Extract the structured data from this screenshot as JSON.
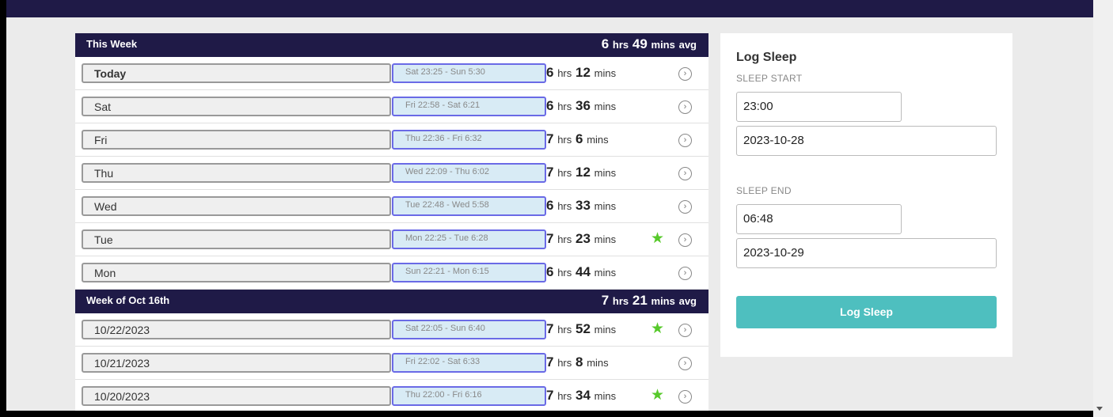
{
  "weeks": [
    {
      "title": "This Week",
      "avg_hrs": "6",
      "avg_mins": "49",
      "days": [
        {
          "label": "Today",
          "range": "Sat 23:25 - Sun 5:30",
          "hrs": "6",
          "mins": "12",
          "star": false
        },
        {
          "label": "Sat",
          "range": "Fri 22:58 - Sat 6:21",
          "hrs": "6",
          "mins": "36",
          "star": false
        },
        {
          "label": "Fri",
          "range": "Thu 22:36 - Fri 6:32",
          "hrs": "7",
          "mins": "6",
          "star": false
        },
        {
          "label": "Thu",
          "range": "Wed 22:09 - Thu 6:02",
          "hrs": "7",
          "mins": "12",
          "star": false
        },
        {
          "label": "Wed",
          "range": "Tue 22:48 - Wed 5:58",
          "hrs": "6",
          "mins": "33",
          "star": false
        },
        {
          "label": "Tue",
          "range": "Mon 22:25 - Tue 6:28",
          "hrs": "7",
          "mins": "23",
          "star": true
        },
        {
          "label": "Mon",
          "range": "Sun 22:21 - Mon 6:15",
          "hrs": "6",
          "mins": "44",
          "star": false
        }
      ]
    },
    {
      "title": "Week of Oct 16th",
      "avg_hrs": "7",
      "avg_mins": "21",
      "days": [
        {
          "label": "10/22/2023",
          "range": "Sat 22:05 - Sun 6:40",
          "hrs": "7",
          "mins": "52",
          "star": true
        },
        {
          "label": "10/21/2023",
          "range": "Fri 22:02 - Sat 6:33",
          "hrs": "7",
          "mins": "8",
          "star": false
        },
        {
          "label": "10/20/2023",
          "range": "Thu 22:00 - Fri 6:16",
          "hrs": "7",
          "mins": "34",
          "star": true
        }
      ]
    }
  ],
  "units": {
    "hrs": "hrs",
    "mins": "mins",
    "avg": "avg"
  },
  "icons": {
    "star": "star-icon",
    "detail": "chevron-right-circle-icon"
  },
  "colors": {
    "header_bg": "#1f1a47",
    "range_border": "#6a6ae6",
    "range_bg": "#d8ebf5",
    "star": "#57c92b",
    "button": "#4ebfbf"
  },
  "log_panel": {
    "title": "Log Sleep",
    "start_label": "SLEEP START",
    "start_time": "23:00",
    "start_date": "2023-10-28",
    "end_label": "SLEEP END",
    "end_time": "06:48",
    "end_date": "2023-10-29",
    "button_label": "Log Sleep"
  }
}
